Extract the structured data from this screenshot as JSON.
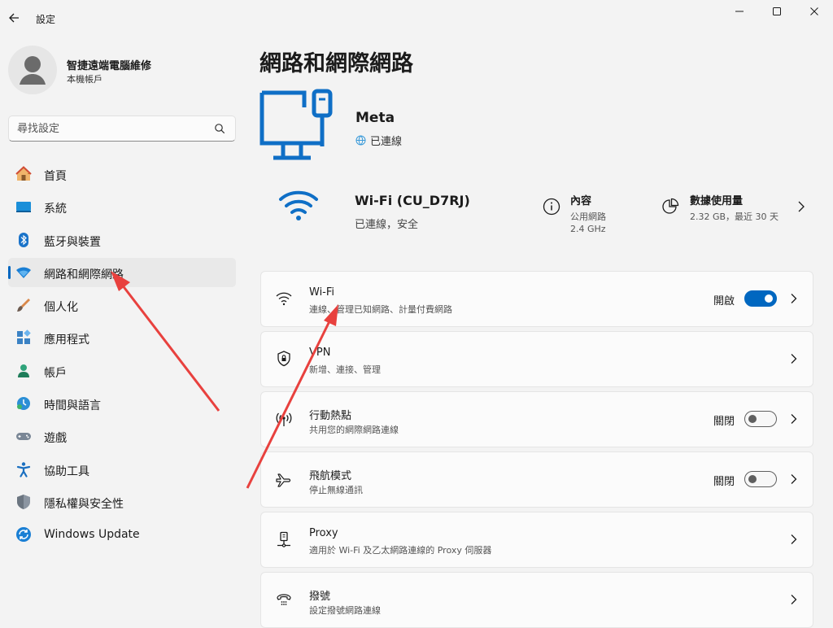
{
  "window": {
    "title": "設定"
  },
  "profile": {
    "name": "智捷遠端電腦維修",
    "account_type": "本機帳戶"
  },
  "search": {
    "placeholder": "尋找設定"
  },
  "sidebar": {
    "items": [
      {
        "label": "首頁",
        "icon": "home-icon"
      },
      {
        "label": "系統",
        "icon": "system-icon"
      },
      {
        "label": "藍牙與裝置",
        "icon": "bluetooth-icon"
      },
      {
        "label": "網路和網際網路",
        "icon": "network-icon",
        "active": true
      },
      {
        "label": "個人化",
        "icon": "personalization-icon"
      },
      {
        "label": "應用程式",
        "icon": "apps-icon"
      },
      {
        "label": "帳戶",
        "icon": "accounts-icon"
      },
      {
        "label": "時間與語言",
        "icon": "time-language-icon"
      },
      {
        "label": "遊戲",
        "icon": "gaming-icon"
      },
      {
        "label": "協助工具",
        "icon": "accessibility-icon"
      },
      {
        "label": "隱私權與安全性",
        "icon": "privacy-icon"
      },
      {
        "label": "Windows Update",
        "icon": "windows-update-icon"
      }
    ]
  },
  "main": {
    "title": "網路和網際網路",
    "device": {
      "name": "Meta",
      "status": "已連線"
    },
    "connection": {
      "name": "Wi-Fi (CU_D7RJ)",
      "status": "已連線，安全",
      "properties": {
        "title": "內容",
        "line1": "公用網路",
        "line2": "2.4 GHz"
      },
      "data_usage": {
        "title": "數據使用量",
        "line1": "2.32 GB，最近 30 天"
      }
    },
    "settings": [
      {
        "title": "Wi-Fi",
        "subtitle": "連線、管理已知網路、計量付費網路",
        "icon": "wifi-icon",
        "state": "開啟",
        "toggle": true
      },
      {
        "title": "VPN",
        "subtitle": "新增、連接、管理",
        "icon": "vpn-shield-icon"
      },
      {
        "title": "行動熱點",
        "subtitle": "共用您的網際網路連線",
        "icon": "hotspot-icon",
        "state": "關閉",
        "toggle": false
      },
      {
        "title": "飛航模式",
        "subtitle": "停止無線通訊",
        "icon": "airplane-icon",
        "state": "關閉",
        "toggle": false
      },
      {
        "title": "Proxy",
        "subtitle": "適用於 Wi-Fi 及乙太網路連線的 Proxy 伺服器",
        "icon": "proxy-icon"
      },
      {
        "title": "撥號",
        "subtitle": "設定撥號網路連線",
        "icon": "dialup-icon"
      }
    ]
  },
  "colors": {
    "accent": "#0067c0",
    "annotation_arrow": "#e8413e",
    "window_bg": "#f3f3f3",
    "card_bg": "#fbfbfb"
  }
}
